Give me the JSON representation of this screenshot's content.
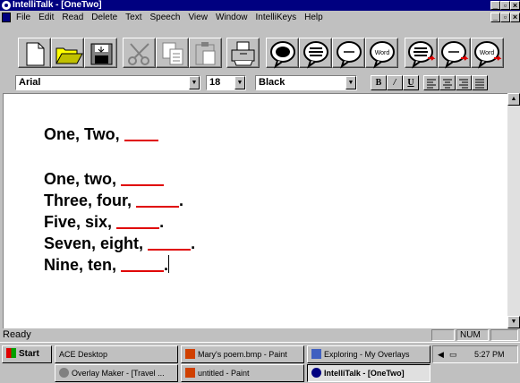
{
  "window": {
    "title": "IntelliTalk - [OneTwo]"
  },
  "menu": [
    "File",
    "Edit",
    "Read",
    "Delete",
    "Text",
    "Speech",
    "View",
    "Window",
    "IntelliKeys",
    "Help"
  ],
  "toolbar": {
    "tools": [
      "new-document",
      "open",
      "save",
      "cut",
      "copy",
      "paste",
      "print",
      "speak-letter",
      "speak-word",
      "speak-sentence",
      "speak-paragraph",
      "word-bubble",
      "speak-next",
      "speak-next-sentence",
      "speak-next-word"
    ],
    "word_label_1": "Word",
    "word_label_2": "Word"
  },
  "format": {
    "font": "Arial",
    "size": "18",
    "color": "Black",
    "bold": "B",
    "italic": "/",
    "underline": "U"
  },
  "document": {
    "lines": [
      {
        "text": "One, Two, ",
        "blank": true,
        "after": ""
      },
      {
        "text": "One, two, ",
        "blank": true,
        "after": ""
      },
      {
        "text": "Three, four, ",
        "blank": true,
        "after": "."
      },
      {
        "text": "Five, six, ",
        "blank": true,
        "after": "."
      },
      {
        "text": "Seven, eight, ",
        "blank": true,
        "after": "."
      },
      {
        "text": "Nine, ten, ",
        "blank": true,
        "after": "."
      }
    ],
    "blank_color": "#e00000"
  },
  "status": {
    "text": "Ready",
    "num": "NUM"
  },
  "taskbar": {
    "start": "Start",
    "tasks": [
      "ACE Desktop",
      "Mary's poem.bmp - Paint",
      "Exploring - My Overlays",
      "Overlay Maker - [Travel ...",
      "untitled - Paint",
      "IntelliTalk - [OneTwo]"
    ],
    "clock": "5:27 PM"
  },
  "colors": {
    "titlebar": "#000080",
    "face": "#c0c0c0"
  }
}
